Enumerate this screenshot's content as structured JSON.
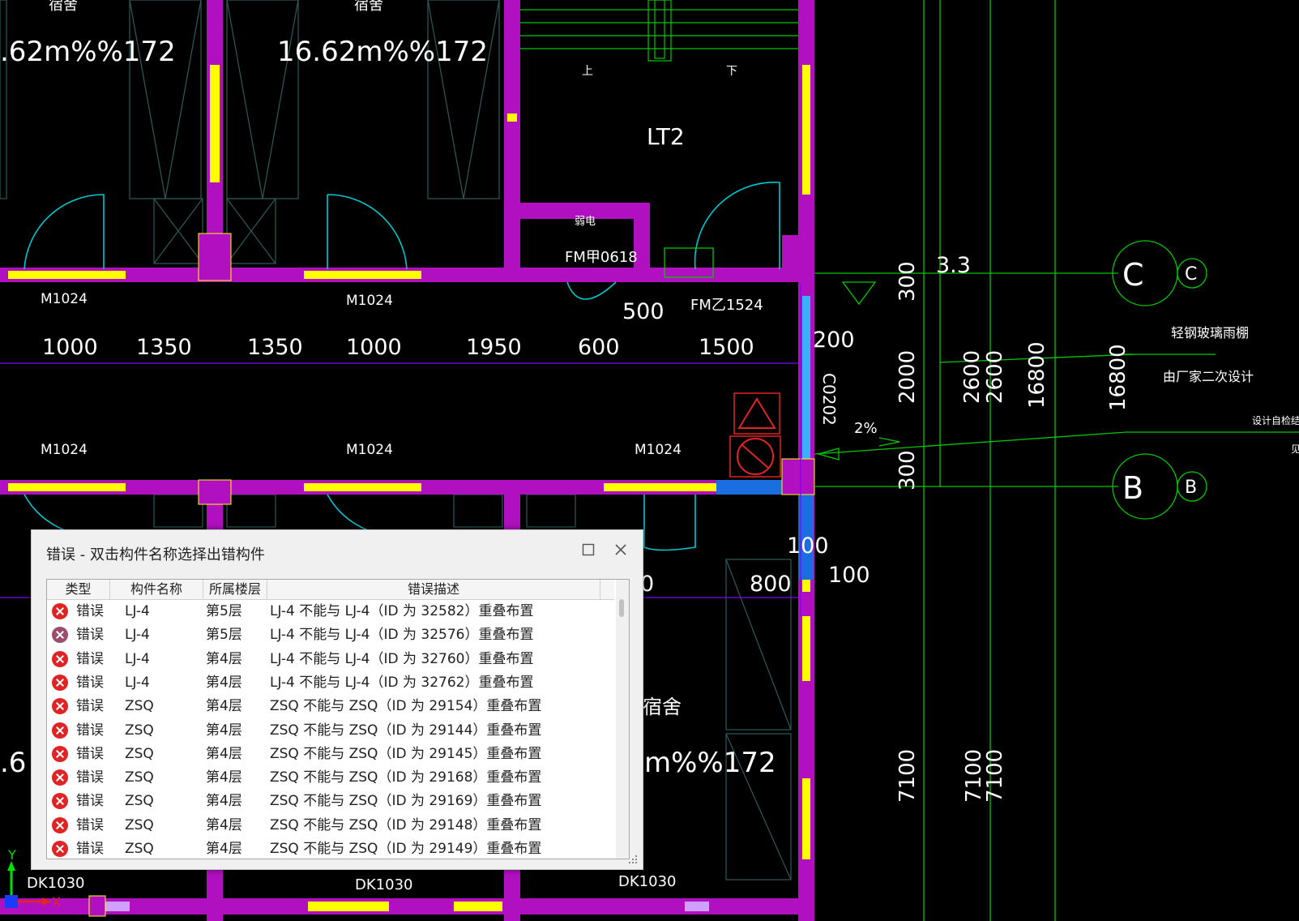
{
  "drawing": {
    "room_labels": [
      "宿舍",
      "宿舍",
      "宿舍"
    ],
    "area_labels": [
      ".62m%%172",
      "16.62m%%172",
      "m%%172",
      ".6"
    ],
    "stair_label": "LT2",
    "stair_up": "上",
    "stair_down": "下",
    "door_labels": [
      "M1024",
      "M1024",
      "M1024",
      "M1024",
      "M1024"
    ],
    "fire_door_labels": [
      "FM甲0618",
      "FM乙1524"
    ],
    "room_tag_small": "弱电",
    "dimensions_horizontal": [
      "1000",
      "1350",
      "1350",
      "1000",
      "1950",
      "600",
      "1500"
    ],
    "dim_500": "500",
    "dim_800": "800",
    "dim_3_3": "3.3",
    "dim_200": "200",
    "dim_100a": "100",
    "dim_100b": "100",
    "dim_0": "0",
    "vertical_dims": [
      "300",
      "2000",
      "2600",
      "2600",
      "16800",
      "16800",
      "300",
      "C0202",
      "7100",
      "7100",
      "7100"
    ],
    "slope": "2%",
    "grid_labels": [
      "C",
      "C",
      "B",
      "B"
    ],
    "notes": [
      "轻钢玻璃雨棚",
      "由厂家二次设计",
      "设计自检结构专业",
      "见"
    ],
    "window_labels": [
      "DK1030",
      "DK1030",
      "DK1030"
    ],
    "axis_x": "X",
    "axis_y": "Y"
  },
  "dialog": {
    "title": "错误 - 双击构件名称选择出错构件",
    "columns": [
      "类型",
      "构件名称",
      "所属楼层",
      "错误描述"
    ],
    "rows": [
      {
        "type": "错误",
        "name": "LJ-4",
        "floor": "第5层",
        "desc": "LJ-4 不能与 LJ-4（ID 为 32582）重叠布置"
      },
      {
        "type": "错误",
        "name": "LJ-4",
        "floor": "第5层",
        "desc": "LJ-4 不能与 LJ-4（ID 为 32576）重叠布置"
      },
      {
        "type": "错误",
        "name": "LJ-4",
        "floor": "第4层",
        "desc": "LJ-4 不能与 LJ-4（ID 为 32760）重叠布置"
      },
      {
        "type": "错误",
        "name": "LJ-4",
        "floor": "第4层",
        "desc": "LJ-4 不能与 LJ-4（ID 为 32762）重叠布置"
      },
      {
        "type": "错误",
        "name": "ZSQ",
        "floor": "第4层",
        "desc": "ZSQ 不能与 ZSQ（ID 为 29154）重叠布置"
      },
      {
        "type": "错误",
        "name": "ZSQ",
        "floor": "第4层",
        "desc": "ZSQ 不能与 ZSQ（ID 为 29144）重叠布置"
      },
      {
        "type": "错误",
        "name": "ZSQ",
        "floor": "第4层",
        "desc": "ZSQ 不能与 ZSQ（ID 为 29145）重叠布置"
      },
      {
        "type": "错误",
        "name": "ZSQ",
        "floor": "第4层",
        "desc": "ZSQ 不能与 ZSQ（ID 为 29168）重叠布置"
      },
      {
        "type": "错误",
        "name": "ZSQ",
        "floor": "第4层",
        "desc": "ZSQ 不能与 ZSQ（ID 为 29169）重叠布置"
      },
      {
        "type": "错误",
        "name": "ZSQ",
        "floor": "第4层",
        "desc": "ZSQ 不能与 ZSQ（ID 为 29148）重叠布置"
      },
      {
        "type": "错误",
        "name": "ZSQ",
        "floor": "第4层",
        "desc": "ZSQ 不能与 ZSQ（ID 为 29149）重叠布置"
      }
    ]
  },
  "colors": {
    "wall": "#b010c0",
    "column_fill": "#ffff00",
    "door_arc": "#00c8d2",
    "grid_line": "#00c800",
    "dim_line": "#8000ff",
    "error_icon": "#e02424"
  }
}
